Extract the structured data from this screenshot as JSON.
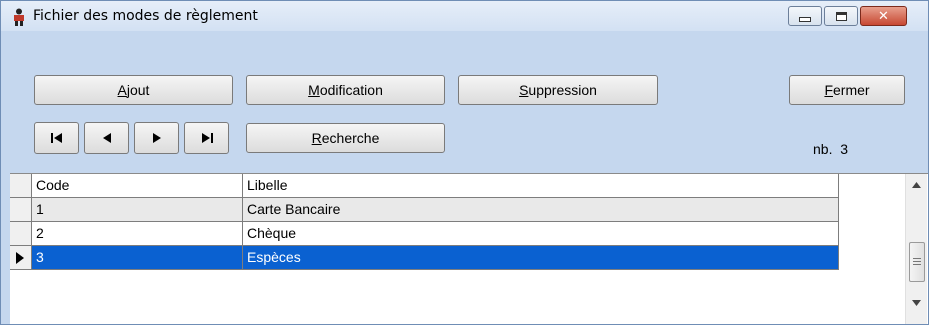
{
  "window": {
    "title": "Fichier des modes de règlement",
    "icons": {
      "app": "app-icon",
      "minimize": "minimize-icon",
      "maximize": "maximize-icon",
      "close": "close-icon"
    },
    "close_glyph": "✕"
  },
  "toolbar": {
    "ajout": {
      "accel": "A",
      "rest": "jout"
    },
    "modification": {
      "accel": "M",
      "rest": "odification"
    },
    "suppression": {
      "accel": "S",
      "rest": "uppression"
    },
    "fermer": {
      "accel": "F",
      "rest": "ermer"
    },
    "recherche": {
      "accel": "R",
      "rest": "echerche"
    }
  },
  "navigation": {
    "first": "first-record-icon",
    "prev": "previous-record-icon",
    "next": "next-record-icon",
    "last": "last-record-icon"
  },
  "count": {
    "label": "nb.",
    "value": "3"
  },
  "grid": {
    "columns": [
      "Code",
      "Libelle"
    ],
    "rows": [
      {
        "code": "1",
        "libelle": "Carte Bancaire"
      },
      {
        "code": "2",
        "libelle": "Chèque"
      },
      {
        "code": "3",
        "libelle": "Espèces"
      }
    ],
    "selected_row": 3
  },
  "colors": {
    "frame": "#c5d7ee",
    "selection": "#0a61d1",
    "close_button": "#c74832"
  }
}
